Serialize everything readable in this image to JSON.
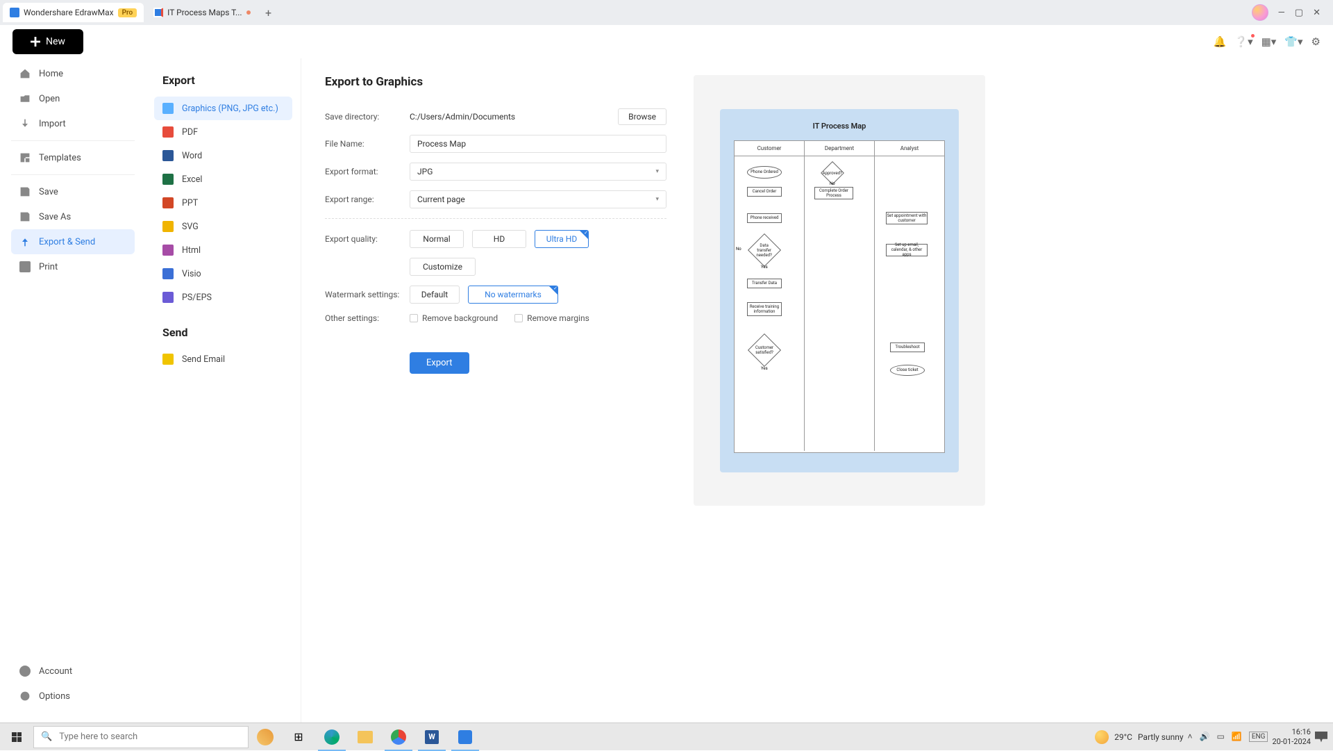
{
  "app": {
    "name": "Wondershare EdrawMax",
    "badge": "Pro",
    "tab2": "IT Process Maps T...",
    "newButton": "New"
  },
  "sidebar": {
    "home": "Home",
    "open": "Open",
    "import": "Import",
    "templates": "Templates",
    "save": "Save",
    "saveAs": "Save As",
    "exportSend": "Export & Send",
    "print": "Print",
    "account": "Account",
    "options": "Options"
  },
  "exportPanel": {
    "title": "Export",
    "graphics": "Graphics (PNG, JPG etc.)",
    "pdf": "PDF",
    "word": "Word",
    "excel": "Excel",
    "ppt": "PPT",
    "svg": "SVG",
    "html": "Html",
    "visio": "Visio",
    "pseps": "PS/EPS",
    "sendTitle": "Send",
    "sendEmail": "Send Email"
  },
  "form": {
    "title": "Export to Graphics",
    "saveDirLabel": "Save directory:",
    "saveDirValue": "C:/Users/Admin/Documents",
    "browse": "Browse",
    "fileNameLabel": "File Name:",
    "fileNameValue": "Process Map",
    "formatLabel": "Export format:",
    "formatValue": "JPG",
    "rangeLabel": "Export range:",
    "rangeValue": "Current page",
    "qualityLabel": "Export quality:",
    "qualityNormal": "Normal",
    "qualityHD": "HD",
    "qualityUltra": "Ultra HD",
    "customize": "Customize",
    "watermarkLabel": "Watermark settings:",
    "watermarkDefault": "Default",
    "watermarkNone": "No watermarks",
    "otherLabel": "Other settings:",
    "removeBg": "Remove background",
    "removeMargins": "Remove margins",
    "exportBtn": "Export"
  },
  "preview": {
    "title": "IT Process Map",
    "col1": "Customer",
    "col2": "Department",
    "col3": "Analyst",
    "s1": "Phone Ordered",
    "s2": "Approved?",
    "s3": "Cancel Order",
    "s4": "Complete Order Process",
    "s5": "Phone received",
    "s6": "Set appointment with customer",
    "s7": "Data transfer needed?",
    "s8": "Set up email, calendar, & other apps",
    "s9": "Transfer Data",
    "s10": "Receive training information",
    "s11": "Customer satisfied?",
    "s12": "Troubleshoot",
    "s13": "Close ticket",
    "yes": "Yes",
    "no": "No"
  },
  "taskbar": {
    "search": "Type here to search",
    "weatherTemp": "29°C",
    "weatherText": "Partly sunny",
    "time": "16:16",
    "date": "20-01-2024"
  }
}
